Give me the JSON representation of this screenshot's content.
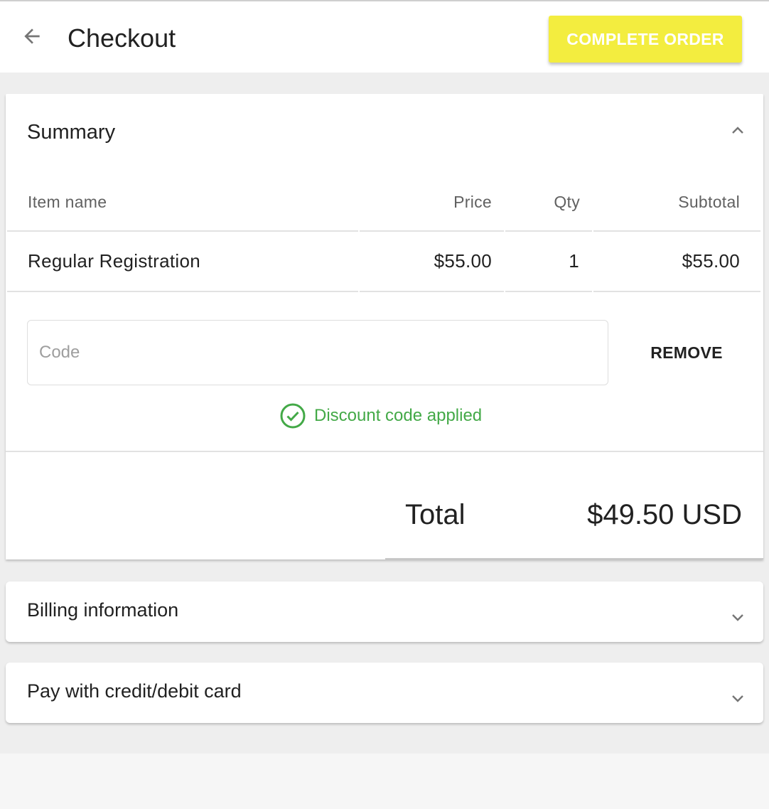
{
  "header": {
    "title": "Checkout",
    "back_icon": "arrow-left-icon",
    "complete_order_label": "COMPLETE ORDER"
  },
  "summary": {
    "title": "Summary",
    "toggle_icon": "chevron-up-icon",
    "columns": {
      "item_name": "Item name",
      "price": "Price",
      "qty": "Qty",
      "subtotal": "Subtotal"
    },
    "items": [
      {
        "name": "Regular Registration",
        "price": "$55.00",
        "qty": "1",
        "subtotal": "$55.00"
      }
    ],
    "discount": {
      "placeholder": "Code",
      "value": "",
      "remove_label": "REMOVE",
      "status_message": "Discount code applied",
      "status_icon": "check-circle-icon"
    },
    "total_label": "Total",
    "total_value": "$49.50 USD"
  },
  "billing": {
    "title": "Billing information",
    "toggle_icon": "chevron-down-icon"
  },
  "payment": {
    "title": "Pay with credit/debit card",
    "toggle_icon": "chevron-down-icon"
  },
  "colors": {
    "accent": "#f3ed3f",
    "success": "#43a947",
    "background": "#eeeeee"
  }
}
